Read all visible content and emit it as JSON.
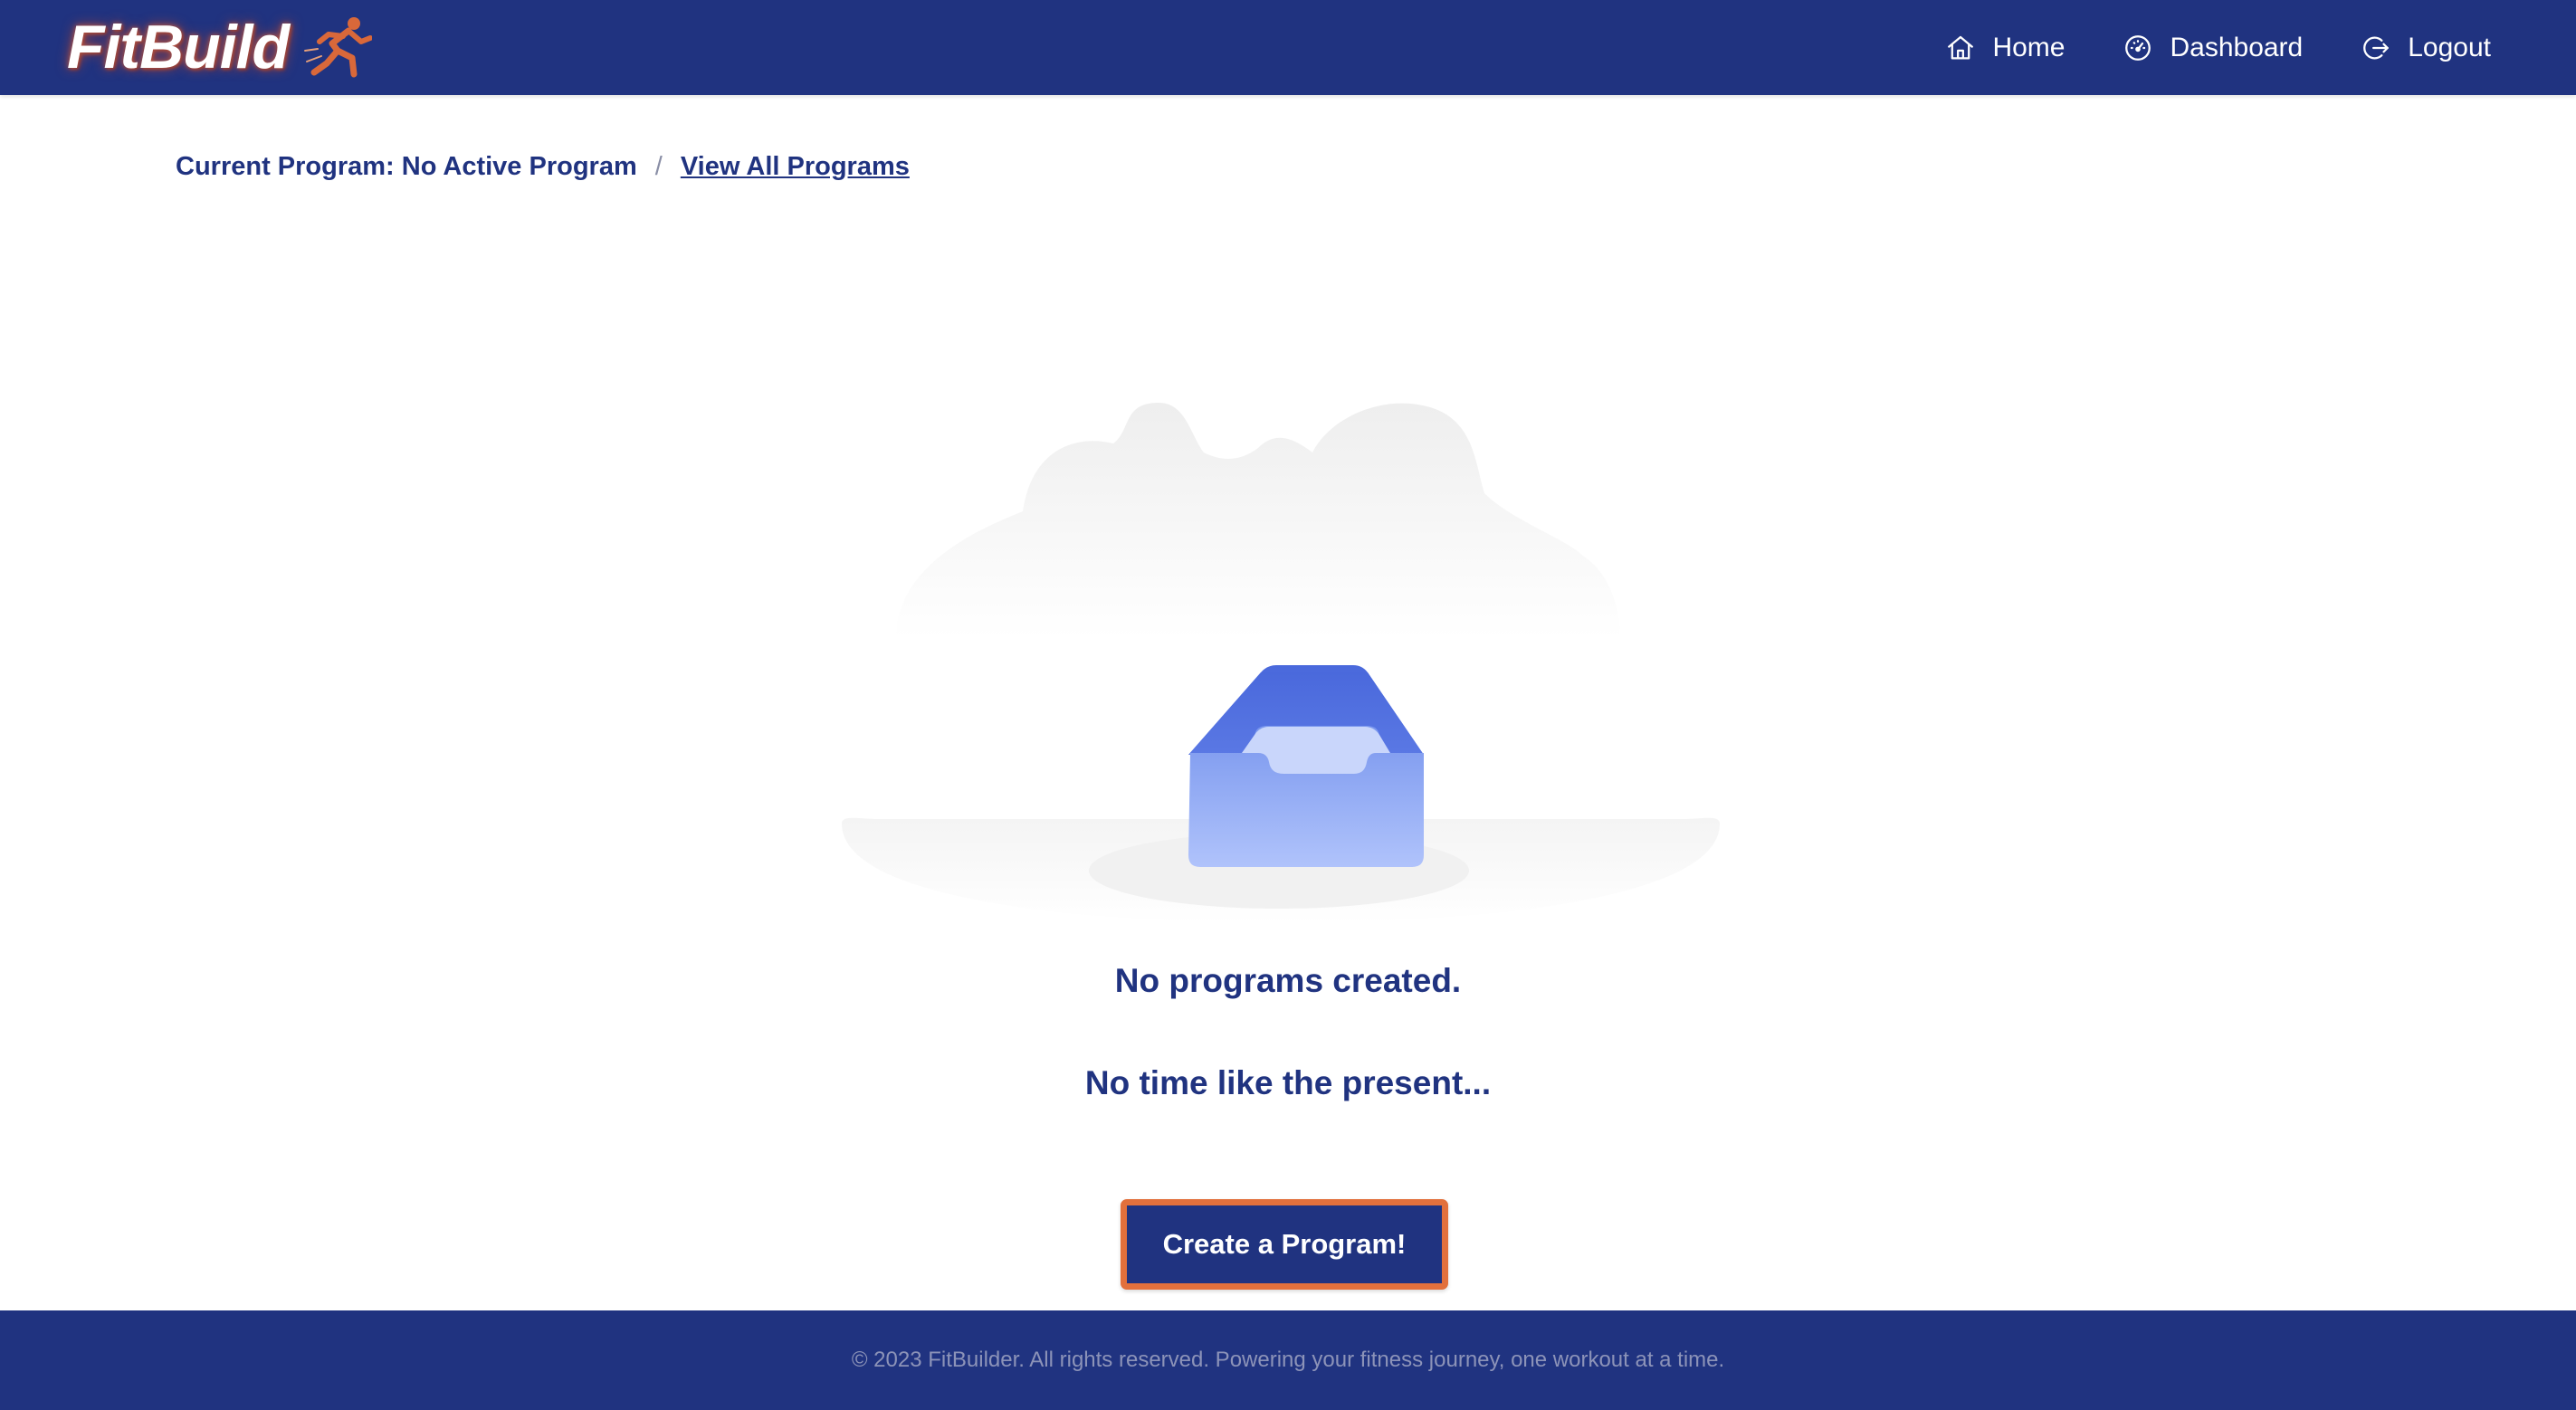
{
  "header": {
    "brand": "FitBuild",
    "brand_icon": "sprinter-icon",
    "nav": {
      "home_label": "Home",
      "dashboard_label": "Dashboard",
      "logout_label": "Logout"
    }
  },
  "breadcrumb": {
    "current": "Current Program: No Active Program",
    "separator": "/",
    "link": "View All Programs"
  },
  "empty_state": {
    "illustration": "empty-inbox-tray-icon",
    "title": "No programs created.",
    "subtitle": "No time like the present...",
    "button_label": "Create a Program!"
  },
  "footer": {
    "text": "© 2023 FitBuilder. All rights reserved. Powering your fitness journey, one workout at a time."
  },
  "colors": {
    "primary": "#203380",
    "accent": "#e2703c",
    "background": "#ffffff",
    "footer_text": "#8c93b8",
    "tray_top": "#4f6fdf",
    "tray_bottom": "#a9bdf8"
  }
}
